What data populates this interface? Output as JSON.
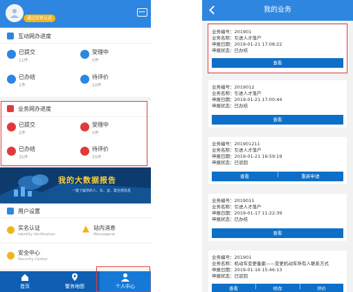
{
  "left": {
    "header": {
      "verify_badge": "通过实名认证"
    },
    "interactive_section": {
      "title": "互动网办进度",
      "items": [
        {
          "label": "已提交",
          "count": "11件",
          "icon": "check-circle-icon",
          "color": "#2e86e0"
        },
        {
          "label": "受理中",
          "count": "0件",
          "icon": "pie-progress-icon",
          "color": "#2e86e0"
        },
        {
          "label": "已办结",
          "count": "1件",
          "icon": "done-icon",
          "color": "#2e86e0"
        },
        {
          "label": "待评价",
          "count": "10件",
          "icon": "star-icon",
          "color": "#2e86e0"
        }
      ]
    },
    "business_section": {
      "title": "业务网办进度",
      "items": [
        {
          "label": "已提交",
          "count": "2件",
          "icon": "check-circle-icon",
          "color": "#e0393b"
        },
        {
          "label": "受理中",
          "count": "0件",
          "icon": "pie-progress-icon",
          "color": "#e0393b"
        },
        {
          "label": "已办结",
          "count": "35件",
          "icon": "done-icon",
          "color": "#e0393b"
        },
        {
          "label": "待评价",
          "count": "35件",
          "icon": "thumb-icon",
          "color": "#e0393b"
        }
      ]
    },
    "banner": {
      "title": "我的大数据报告",
      "subtitle": "一键了解您的人、车、证、案全部信息"
    },
    "user_settings": {
      "title": "用户设置"
    },
    "settings": [
      {
        "label": "实名认证",
        "sub": "Identity Verification",
        "icon": "id-badge-icon"
      },
      {
        "label": "站内消息",
        "sub": "Messagerie",
        "icon": "bell-icon"
      },
      {
        "label": "安全中心",
        "sub": "Security Center",
        "icon": "lock-icon"
      }
    ],
    "tabs": [
      {
        "label": "首页",
        "icon": "home-icon"
      },
      {
        "label": "警务地图",
        "icon": "map-pin-icon"
      },
      {
        "label": "个人中心",
        "icon": "person-icon"
      }
    ]
  },
  "right": {
    "title": "我的业务",
    "records": [
      {
        "number": "业务编号：201901",
        "name": "业务名称：引进人才落户",
        "date": "申报日期：2019-01-21 17:08:22",
        "status": "申报状态：已办结",
        "buttons": [
          "查看"
        ]
      },
      {
        "number": "业务编号：2019012",
        "name": "业务名称：引进人才落户",
        "date": "申报日期：2019-01-21 17:00:44",
        "status": "申报状态：已办结",
        "buttons": [
          "查看"
        ]
      },
      {
        "number": "业务编号：201901211",
        "name": "业务名称：引进人才落户",
        "date": "申报日期：2019-01-21 16:59:19",
        "status": "申报状态：已驳回",
        "buttons": [
          "查看",
          "重新申请"
        ]
      },
      {
        "number": "业务编号：2019011",
        "name": "业务名称：引进人才落户",
        "date": "申报日期：2019-01-17 11:22:39",
        "status": "申报状态：已办结",
        "buttons": [
          "查看"
        ]
      },
      {
        "number": "业务编号：201901",
        "name": "业务名称：机动车变更备案——变更机动车所有人联系方式",
        "date": "申报日期：2019-01-16 15:46:13",
        "status": "申报状态：已驳回",
        "buttons": [
          "查看",
          "修改",
          "评价"
        ]
      }
    ]
  },
  "colors": {
    "primary": "#2e86e0",
    "tabbar": "#0e5fb4",
    "highlight": "#e0393b",
    "badge": "#f2b41d"
  }
}
